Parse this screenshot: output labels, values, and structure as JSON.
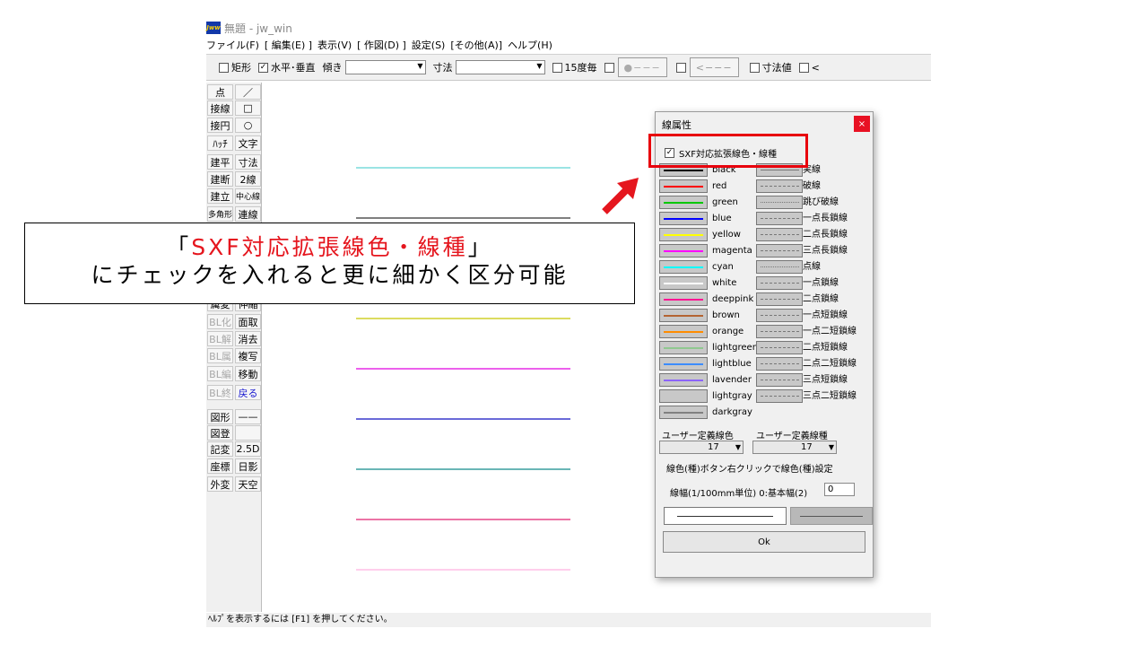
{
  "window": {
    "title": "無題 - jw_win",
    "menu": [
      "ファイル(F)",
      "[ 編集(E) ]",
      "表示(V)",
      "[ 作図(D) ]",
      "設定(S)",
      "[その他(A)]",
      "ヘルプ(H)"
    ]
  },
  "toolbar": {
    "rect_label": "矩形",
    "hv_label": "水平･垂直",
    "hv_checked": "✓",
    "tilt_label": "傾き",
    "dim_label": "寸法",
    "deg15_label": "15度毎",
    "point_btn": "●−−−",
    "arrow_btn": "<−−−",
    "dimval_label": "寸法値",
    "lt_label": "<"
  },
  "left_panel": {
    "col1": [
      {
        "label": "点",
        "state": "normal"
      },
      {
        "label": "接線",
        "state": "normal"
      },
      {
        "label": "接円",
        "state": "normal"
      },
      {
        "label": "ﾊｯﾁ",
        "state": "normal"
      },
      {
        "label": "建平",
        "state": "normal"
      },
      {
        "label": "建断",
        "state": "normal"
      },
      {
        "label": "建立",
        "state": "normal"
      },
      {
        "label": "多角形",
        "state": "normal"
      },
      {
        "label": "属変",
        "state": "normal"
      },
      {
        "label": "BL化",
        "state": "dim"
      },
      {
        "label": "BL解",
        "state": "dim"
      },
      {
        "label": "BL属",
        "state": "dim"
      },
      {
        "label": "BL編",
        "state": "dim"
      },
      {
        "label": "BL終",
        "state": "dim"
      },
      {
        "label": "図形",
        "state": "normal"
      },
      {
        "label": "図登",
        "state": "normal"
      },
      {
        "label": "記変",
        "state": "normal"
      },
      {
        "label": "座標",
        "state": "normal"
      },
      {
        "label": "外変",
        "state": "normal"
      }
    ],
    "col2": [
      {
        "label": "／",
        "state": "normal"
      },
      {
        "label": "□",
        "state": "normal"
      },
      {
        "label": "○",
        "state": "normal"
      },
      {
        "label": "文字",
        "state": "normal"
      },
      {
        "label": "寸法",
        "state": "normal"
      },
      {
        "label": "2線",
        "state": "normal"
      },
      {
        "label": "中心線",
        "state": "normal"
      },
      {
        "label": "連線",
        "state": "normal"
      },
      {
        "label": "伸縮",
        "state": "normal"
      },
      {
        "label": "面取",
        "state": "normal"
      },
      {
        "label": "消去",
        "state": "normal"
      },
      {
        "label": "複写",
        "state": "normal"
      },
      {
        "label": "移動",
        "state": "normal"
      },
      {
        "label": "戻る",
        "state": "blue"
      },
      {
        "label": "——",
        "state": "normal"
      },
      {
        "label": "",
        "state": "normal"
      },
      {
        "label": "2.5D",
        "state": "normal"
      },
      {
        "label": "日影",
        "state": "normal"
      },
      {
        "label": "天空",
        "state": "normal"
      }
    ]
  },
  "canvas_lines": [
    "#5fd3d3",
    "#333333",
    "#c8c800",
    "#e000e0",
    "#1010c0",
    "#108a8a",
    "#e02070",
    "#ffb0e0"
  ],
  "dialog": {
    "title": "線属性",
    "close": "×",
    "sxf_label": "SXF対応拡張線色・線種",
    "sxf_checked": "✓",
    "colors": [
      {
        "name": "black",
        "hex": "#000000"
      },
      {
        "name": "red",
        "hex": "#ff0000"
      },
      {
        "name": "green",
        "hex": "#00c800"
      },
      {
        "name": "blue",
        "hex": "#0000ff"
      },
      {
        "name": "yellow",
        "hex": "#ffff00"
      },
      {
        "name": "magenta",
        "hex": "#ff00ff"
      },
      {
        "name": "cyan",
        "hex": "#00ffff"
      },
      {
        "name": "white",
        "hex": "#ffffff"
      },
      {
        "name": "deeppink",
        "hex": "#ff1493"
      },
      {
        "name": "brown",
        "hex": "#b46432"
      },
      {
        "name": "orange",
        "hex": "#ff8c00"
      },
      {
        "name": "lightgreen",
        "hex": "#90c890"
      },
      {
        "name": "lightblue",
        "hex": "#3c8cff"
      },
      {
        "name": "lavender",
        "hex": "#8c64ff"
      },
      {
        "name": "lightgray",
        "hex": "#c8c8c8"
      },
      {
        "name": "darkgray",
        "hex": "#808080"
      }
    ],
    "types": [
      {
        "name": "実線",
        "dash": "solid"
      },
      {
        "name": "破線",
        "dash": "dashed"
      },
      {
        "name": "跳び破線",
        "dash": "dotted"
      },
      {
        "name": "一点長鎖線",
        "dash": "dashed"
      },
      {
        "name": "二点長鎖線",
        "dash": "dashed"
      },
      {
        "name": "三点長鎖線",
        "dash": "dashed"
      },
      {
        "name": "点線",
        "dash": "dotted"
      },
      {
        "name": "一点鎖線",
        "dash": "dashed"
      },
      {
        "name": "二点鎖線",
        "dash": "dashed"
      },
      {
        "name": "一点短鎖線",
        "dash": "dashed"
      },
      {
        "name": "一点二短鎖線",
        "dash": "dashed"
      },
      {
        "name": "二点短鎖線",
        "dash": "dashed"
      },
      {
        "name": "二点二短鎖線",
        "dash": "dashed"
      },
      {
        "name": "三点短鎖線",
        "dash": "dashed"
      },
      {
        "name": "三点二短鎖線",
        "dash": "dashed"
      }
    ],
    "user_color_label": "ユーザー定義線色",
    "user_type_label": "ユーザー定義線種",
    "user_color_value": "17",
    "user_type_value": "17",
    "hint": "線色(種)ボタン右クリックで線色(種)設定",
    "width_label": "線幅(1/100mm単位) 0:基本幅(2)",
    "width_value": "0",
    "ok": "Ok"
  },
  "status": "ﾍﾙﾌﾟを表示するには [F1] を押してください。",
  "callout": {
    "open_bracket": "「",
    "highlight": "SXF対応拡張線色・線種",
    "close_bracket": "」",
    "line2": "にチェックを入れると更に細かく区分可能",
    "accent": "#e5161e"
  }
}
